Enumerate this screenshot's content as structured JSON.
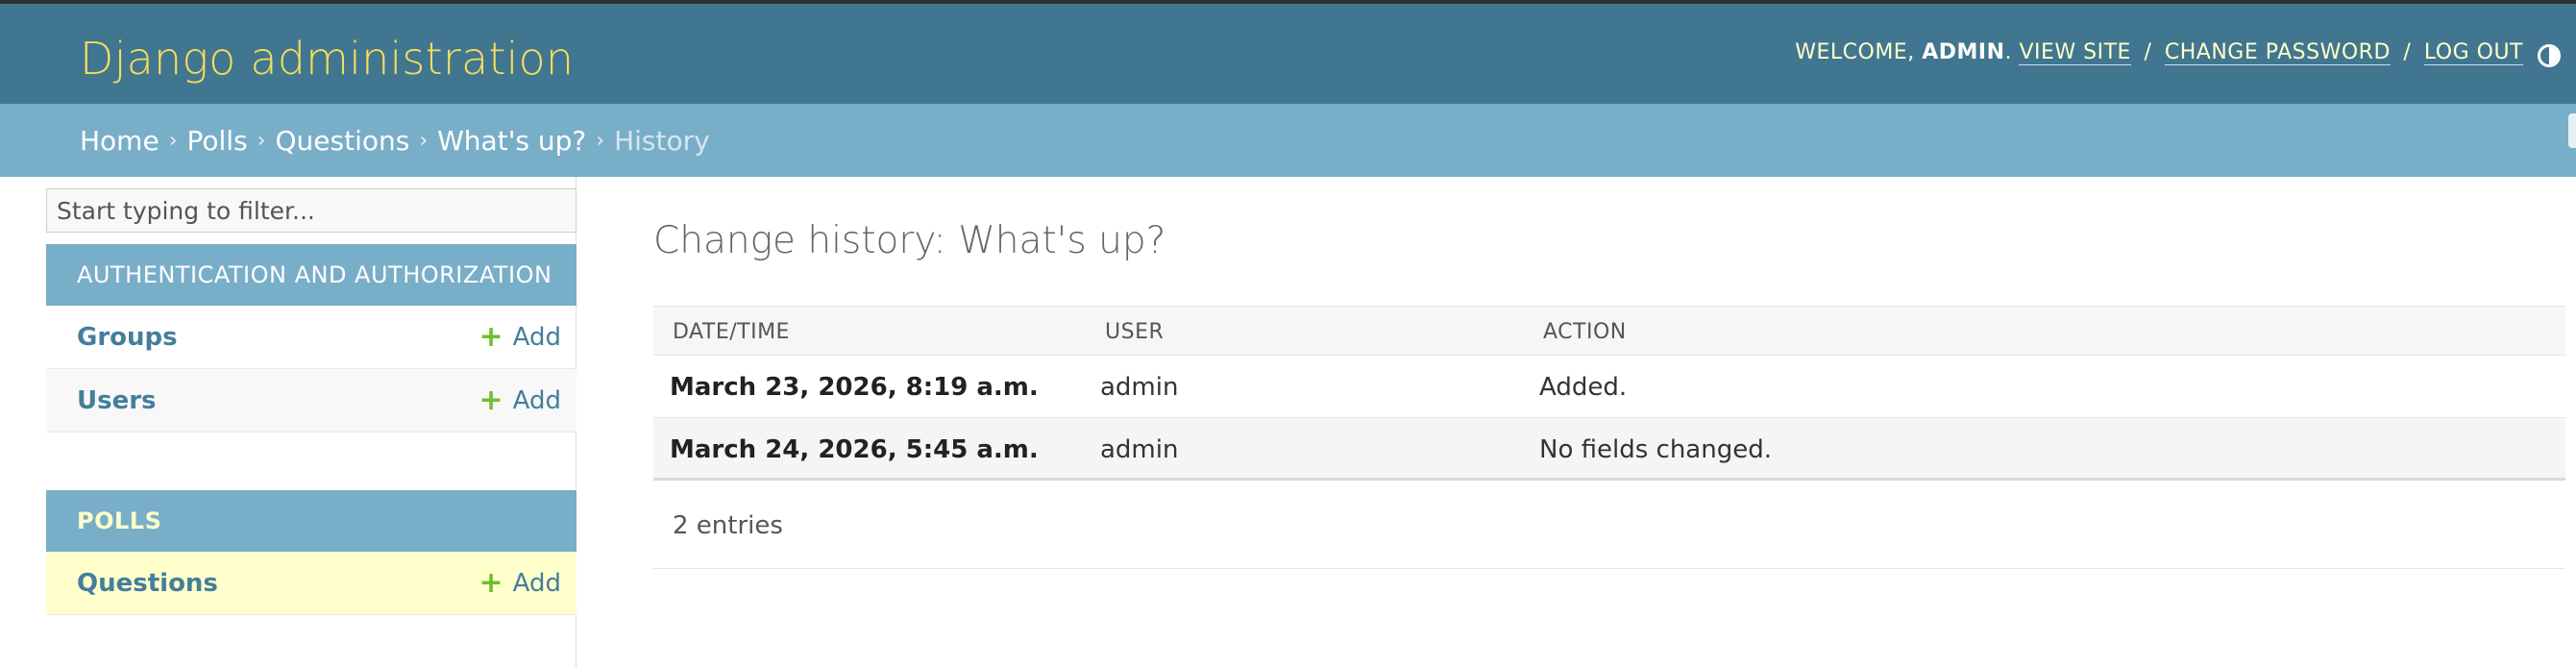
{
  "header": {
    "branding": "Django administration",
    "welcome_prefix": "WELCOME,",
    "username": "ADMIN",
    "welcome_suffix": ".",
    "view_site": "VIEW SITE",
    "change_password": "CHANGE PASSWORD",
    "log_out": "LOG OUT",
    "separator": "/",
    "theme_icon": "contrast-toggle-icon"
  },
  "breadcrumbs": {
    "items": [
      "Home",
      "Polls",
      "Questions",
      "What's up?"
    ],
    "current": "History",
    "chevron": "›"
  },
  "sidebar": {
    "filter_placeholder": "Start typing to filter...",
    "modules": [
      {
        "caption": "AUTHENTICATION AND AUTHORIZATION",
        "models": [
          {
            "label": "Groups",
            "add": "Add"
          },
          {
            "label": "Users",
            "add": "Add"
          }
        ]
      },
      {
        "caption": "POLLS",
        "models": [
          {
            "label": "Questions",
            "add": "Add"
          }
        ]
      }
    ],
    "plus_glyph": "+"
  },
  "content": {
    "title": "Change history: What's up?",
    "columns": [
      "DATE/TIME",
      "USER",
      "ACTION"
    ],
    "rows": [
      {
        "datetime": "March 23, 2026, 8:19 a.m.",
        "user": "admin",
        "action": "Added."
      },
      {
        "datetime": "March 24, 2026, 5:45 a.m.",
        "user": "admin",
        "action": "No fields changed."
      }
    ],
    "footer": "2 entries"
  },
  "colors": {
    "header_bg": "#417690",
    "breadcrumb_bg": "#79aec8",
    "branding": "#f5dd5d",
    "link": "#447e9b",
    "add_icon": "#70bf2b",
    "selected_row": "#ffffcc"
  }
}
